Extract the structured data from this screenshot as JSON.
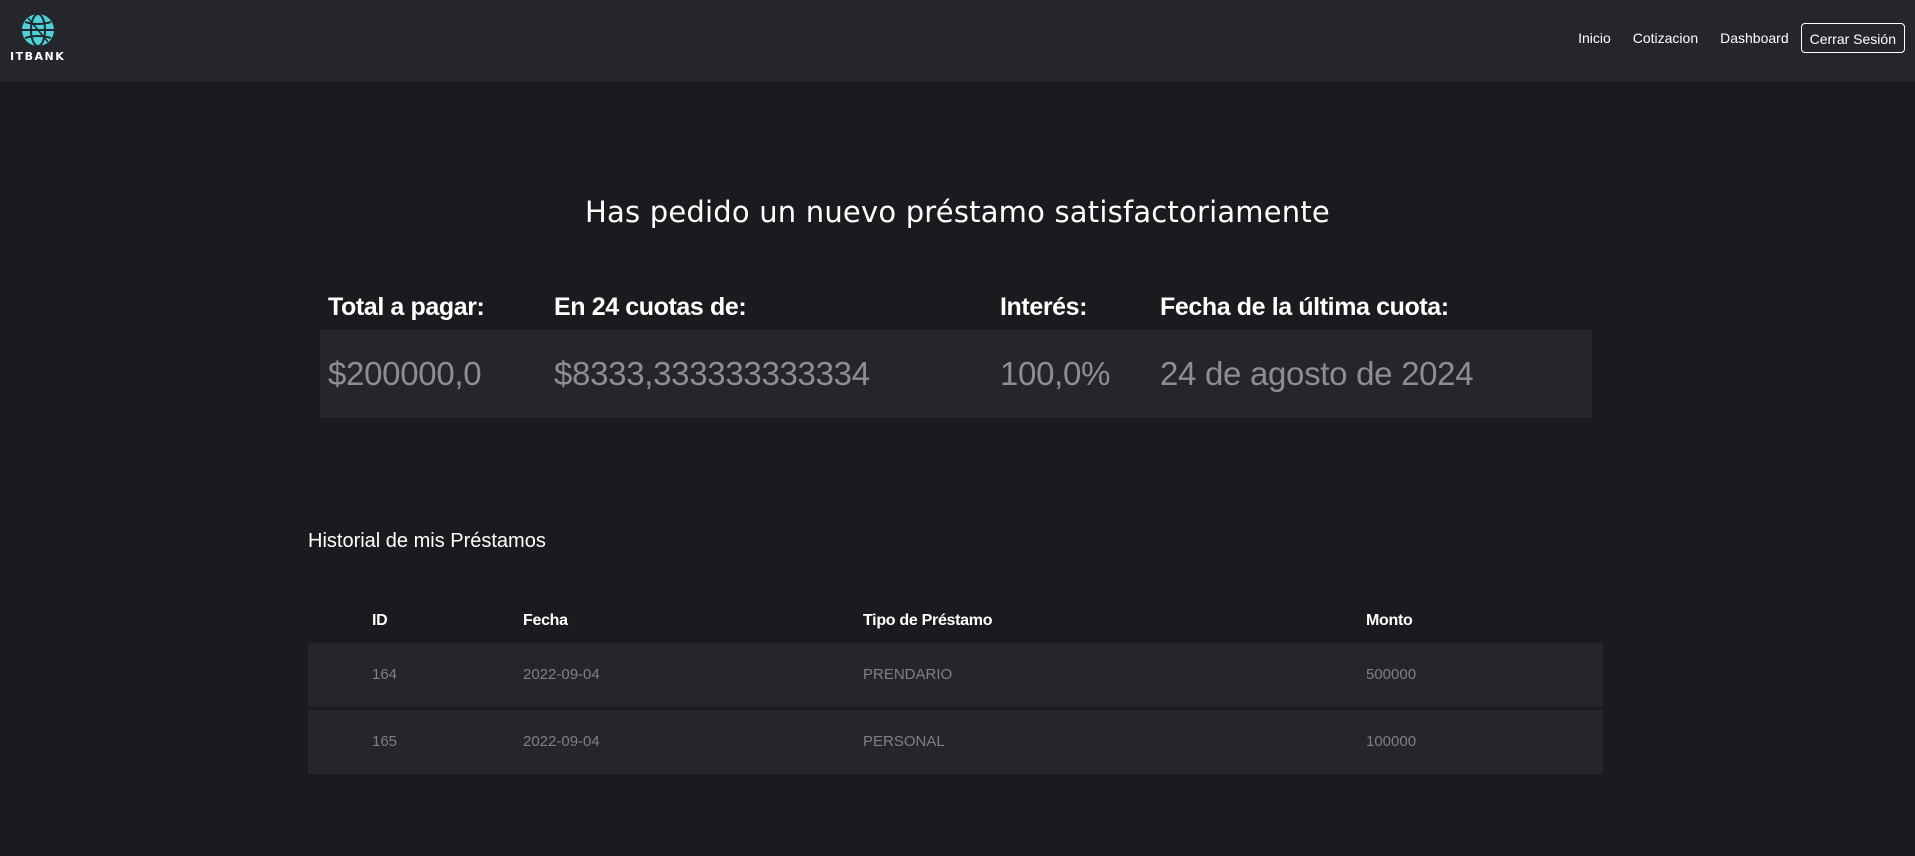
{
  "header": {
    "brand_text": "ITBANK",
    "nav": {
      "inicio": "Inicio",
      "cotizacion": "Cotizacion",
      "dashboard": "Dashboard",
      "logout": "Cerrar Sesión"
    }
  },
  "main": {
    "success_title": "Has pedido un nuevo préstamo satisfactoriamente",
    "summary": {
      "headers": {
        "total": "Total a pagar:",
        "cuotas": "En 24 cuotas de:",
        "interes": "Interés:",
        "fecha": "Fecha de la última cuota:"
      },
      "values": {
        "total": "$200000,0",
        "cuotas": "$8333,333333333334",
        "interes": "100,0%",
        "fecha": "24 de agosto de 2024"
      }
    },
    "history": {
      "title": "Historial de mis Préstamos",
      "columns": {
        "id": "ID",
        "fecha": "Fecha",
        "tipo": "Tipo de Préstamo",
        "monto": "Monto"
      },
      "rows": [
        {
          "id": "164",
          "fecha": "2022-09-04",
          "tipo": "PRENDARIO",
          "monto": "500000"
        },
        {
          "id": "165",
          "fecha": "2022-09-04",
          "tipo": "PERSONAL",
          "monto": "100000"
        }
      ]
    }
  },
  "colors": {
    "page_bg": "#1b1b1f",
    "navbar_bg": "#24262b",
    "row_bg": "#26262a",
    "logo_accent": "#4fd1d9",
    "muted_text": "#8d8d92"
  },
  "icons": {
    "brand_logo": "globe-icon"
  }
}
